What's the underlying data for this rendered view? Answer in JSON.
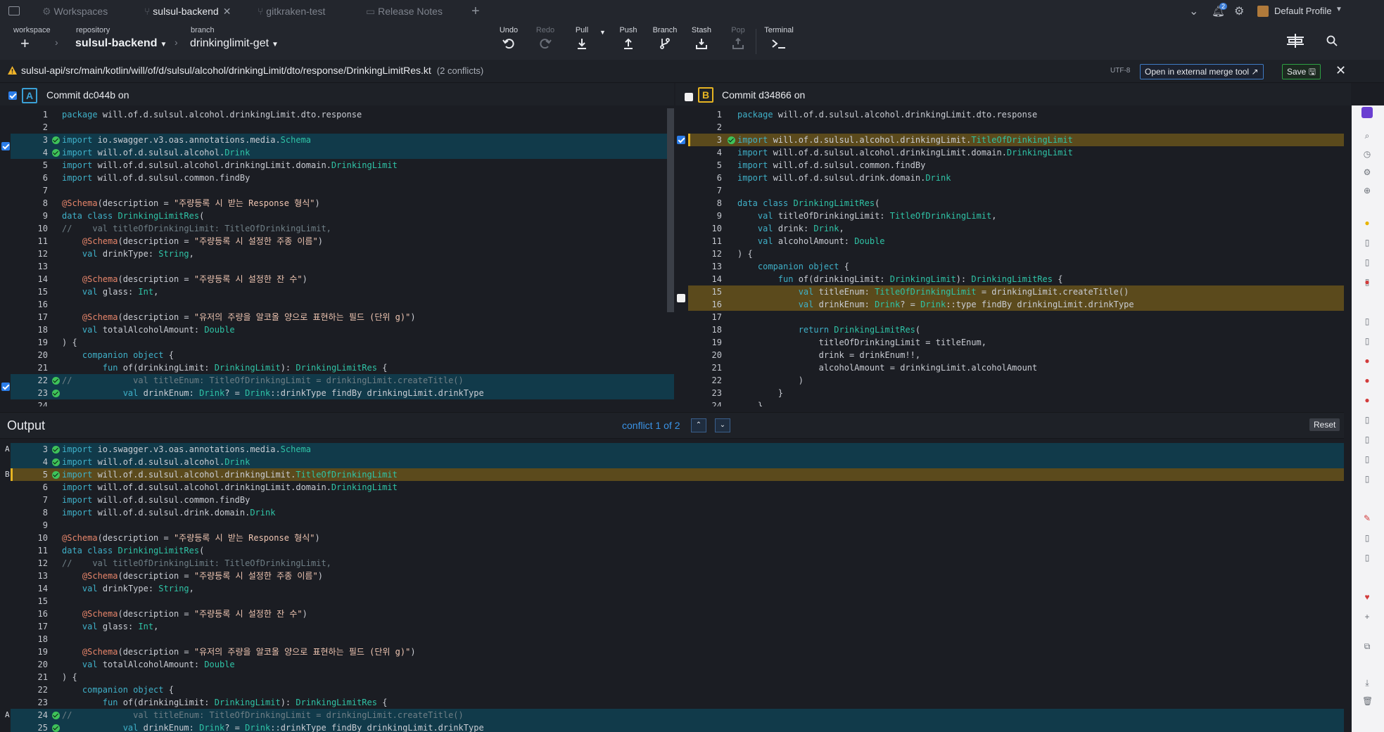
{
  "tabs": [
    {
      "label": "Workspaces",
      "active": false
    },
    {
      "label": "sulsul-backend",
      "active": true,
      "closable": true
    },
    {
      "label": "gitkraken-test",
      "active": false
    },
    {
      "label": "Release Notes",
      "active": false
    }
  ],
  "topright": {
    "profile": "Default Profile",
    "notification_count": "2"
  },
  "toolbar": {
    "workspace_label": "workspace",
    "repository_label": "repository",
    "repository": "sulsul-backend",
    "branch_label": "branch",
    "branch": "drinkinglimit-get",
    "undo": "Undo",
    "redo": "Redo",
    "pull": "Pull",
    "push": "Push",
    "branch_btn": "Branch",
    "stash": "Stash",
    "pop": "Pop",
    "terminal": "Terminal"
  },
  "filebar": {
    "path": "sulsul-api/src/main/kotlin/will/of/d/sulsul/alcohol/drinkingLimit/dto/response/DrinkingLimitRes.kt",
    "conflicts": "(2 conflicts)",
    "encoding": "UTF-8",
    "external_tool": "Open in external merge tool",
    "save": "Save"
  },
  "pane_a": {
    "letter": "A",
    "title": "Commit dc044b on"
  },
  "pane_b": {
    "letter": "B",
    "title": "Commit d34866 on"
  },
  "output": {
    "title": "Output",
    "conflict_nav": "conflict 1 of 2",
    "reset": "Reset"
  },
  "colors": {
    "accent_a": "#3aa0d6",
    "accent_b": "#e6b422",
    "hl_a": "#113a4a",
    "hl_b": "#5b4a1c"
  }
}
